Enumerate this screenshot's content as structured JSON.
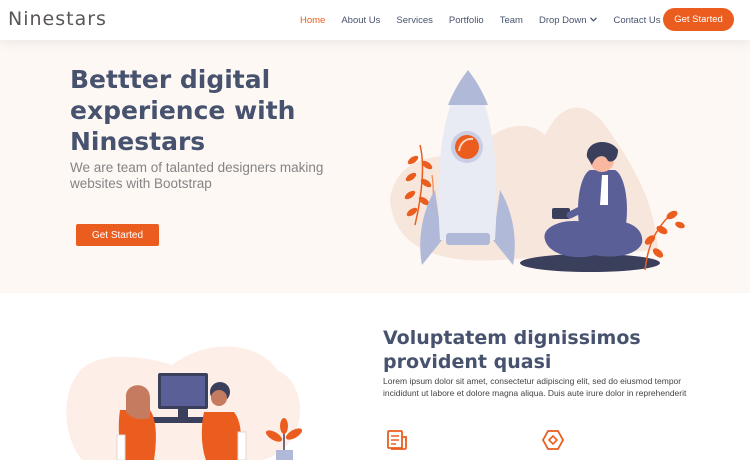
{
  "header": {
    "logo": "Ninestars",
    "nav": [
      {
        "label": "Home",
        "active": true
      },
      {
        "label": "About Us",
        "active": false
      },
      {
        "label": "Services",
        "active": false
      },
      {
        "label": "Portfolio",
        "active": false
      },
      {
        "label": "Team",
        "active": false
      },
      {
        "label": "Drop Down",
        "active": false,
        "dropdown": true
      },
      {
        "label": "Contact Us",
        "active": false
      }
    ],
    "cta": "Get Started"
  },
  "hero": {
    "title_lines": [
      "Bettter digital",
      "experience with",
      "Ninestars"
    ],
    "subtitle": "We are team of talanted designers making websites with Bootstrap",
    "cta": "Get Started"
  },
  "about": {
    "title_lines": [
      "Voluptatem dignissimos",
      "provident quasi"
    ],
    "text": "Lorem ipsum dolor sit amet, consectetur adipiscing elit, sed do eiusmod tempor incididunt ut labore et dolore magna aliqua. Duis aute irure dolor in reprehenderit",
    "icons": [
      "receipt-icon",
      "cube-icon"
    ]
  },
  "colors": {
    "accent": "#eb5d1e",
    "heading": "#47536e",
    "hero_bg": "#fef8f5"
  },
  "icons": [
    "chevron-down-icon",
    "rocket-illustration",
    "person-laptop-illustration",
    "team-desk-illustration"
  ]
}
